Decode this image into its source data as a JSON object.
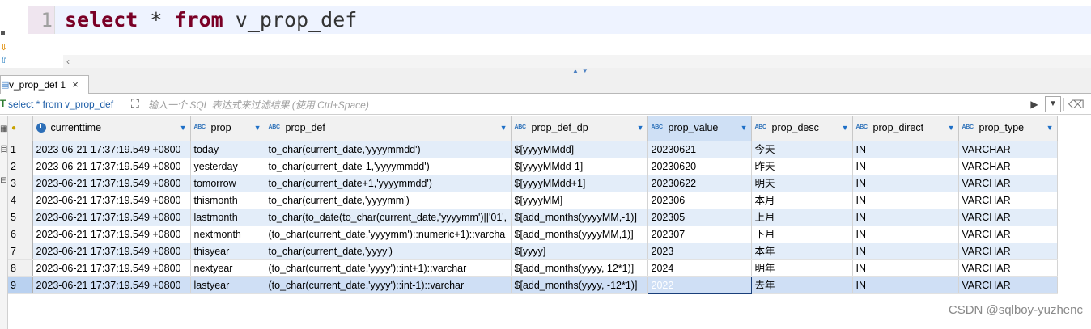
{
  "editor": {
    "line_number": "1",
    "code": {
      "kw_select": "select",
      "star": "*",
      "kw_from": "from",
      "table": "v_prop_def"
    }
  },
  "tab": {
    "label": "v_prop_def 1",
    "close": "×"
  },
  "filter": {
    "query_text": "select * from v_prop_def",
    "placeholder": "输入一个 SQL 表达式来过滤结果 (使用 Ctrl+Space)"
  },
  "grid": {
    "columns": [
      {
        "name": "currenttime",
        "type_icon": "clock-icon"
      },
      {
        "name": "prop",
        "type_icon": "ABC"
      },
      {
        "name": "prop_def",
        "type_icon": "ABC"
      },
      {
        "name": "prop_def_dp",
        "type_icon": "ABC"
      },
      {
        "name": "prop_value",
        "type_icon": "ABC"
      },
      {
        "name": "prop_desc",
        "type_icon": "ABC"
      },
      {
        "name": "prop_direct",
        "type_icon": "ABC"
      },
      {
        "name": "prop_type",
        "type_icon": "ABC"
      }
    ],
    "rows": [
      [
        "1",
        "2023-06-21 17:37:19.549 +0800",
        "today",
        "to_char(current_date,'yyyymmdd')",
        "$[yyyyMMdd]",
        "20230621",
        "今天",
        "IN",
        "VARCHAR"
      ],
      [
        "2",
        "2023-06-21 17:37:19.549 +0800",
        "yesterday",
        "to_char(current_date-1,'yyyymmdd')",
        "$[yyyyMMdd-1]",
        "20230620",
        "昨天",
        "IN",
        "VARCHAR"
      ],
      [
        "3",
        "2023-06-21 17:37:19.549 +0800",
        "tomorrow",
        "to_char(current_date+1,'yyyymmdd')",
        "$[yyyyMMdd+1]",
        "20230622",
        "明天",
        "IN",
        "VARCHAR"
      ],
      [
        "4",
        "2023-06-21 17:37:19.549 +0800",
        "thismonth",
        "to_char(current_date,'yyyymm')",
        "$[yyyyMM]",
        "202306",
        "本月",
        "IN",
        "VARCHAR"
      ],
      [
        "5",
        "2023-06-21 17:37:19.549 +0800",
        "lastmonth",
        "to_char(to_date(to_char(current_date,'yyyymm')||'01',",
        "$[add_months(yyyyMM,-1)]",
        "202305",
        "上月",
        "IN",
        "VARCHAR"
      ],
      [
        "6",
        "2023-06-21 17:37:19.549 +0800",
        "nextmonth",
        "(to_char(current_date,'yyyymm')::numeric+1)::varcha",
        "$[add_months(yyyyMM,1)]",
        "202307",
        "下月",
        "IN",
        "VARCHAR"
      ],
      [
        "7",
        "2023-06-21 17:37:19.549 +0800",
        "thisyear",
        "to_char(current_date,'yyyy')",
        "$[yyyy]",
        "2023",
        "本年",
        "IN",
        "VARCHAR"
      ],
      [
        "8",
        "2023-06-21 17:37:19.549 +0800",
        "nextyear",
        "(to_char(current_date,'yyyy')::int+1)::varchar",
        "$[add_months(yyyy, 12*1)]",
        "2024",
        "明年",
        "IN",
        "VARCHAR"
      ],
      [
        "9",
        "2023-06-21 17:37:19.549 +0800",
        "lastyear",
        "(to_char(current_date,'yyyy')::int-1)::varchar",
        "$[add_months(yyyy, -12*1)]",
        "2022",
        "去年",
        "IN",
        "VARCHAR"
      ]
    ],
    "selected_row": 8,
    "selected_col": 5
  },
  "watermark": "CSDN @sqlboy-yuzhenc",
  "colors": {
    "keyword": "#7a0026",
    "row_alt": "#e3edf9",
    "selection": "#3f78c8"
  }
}
